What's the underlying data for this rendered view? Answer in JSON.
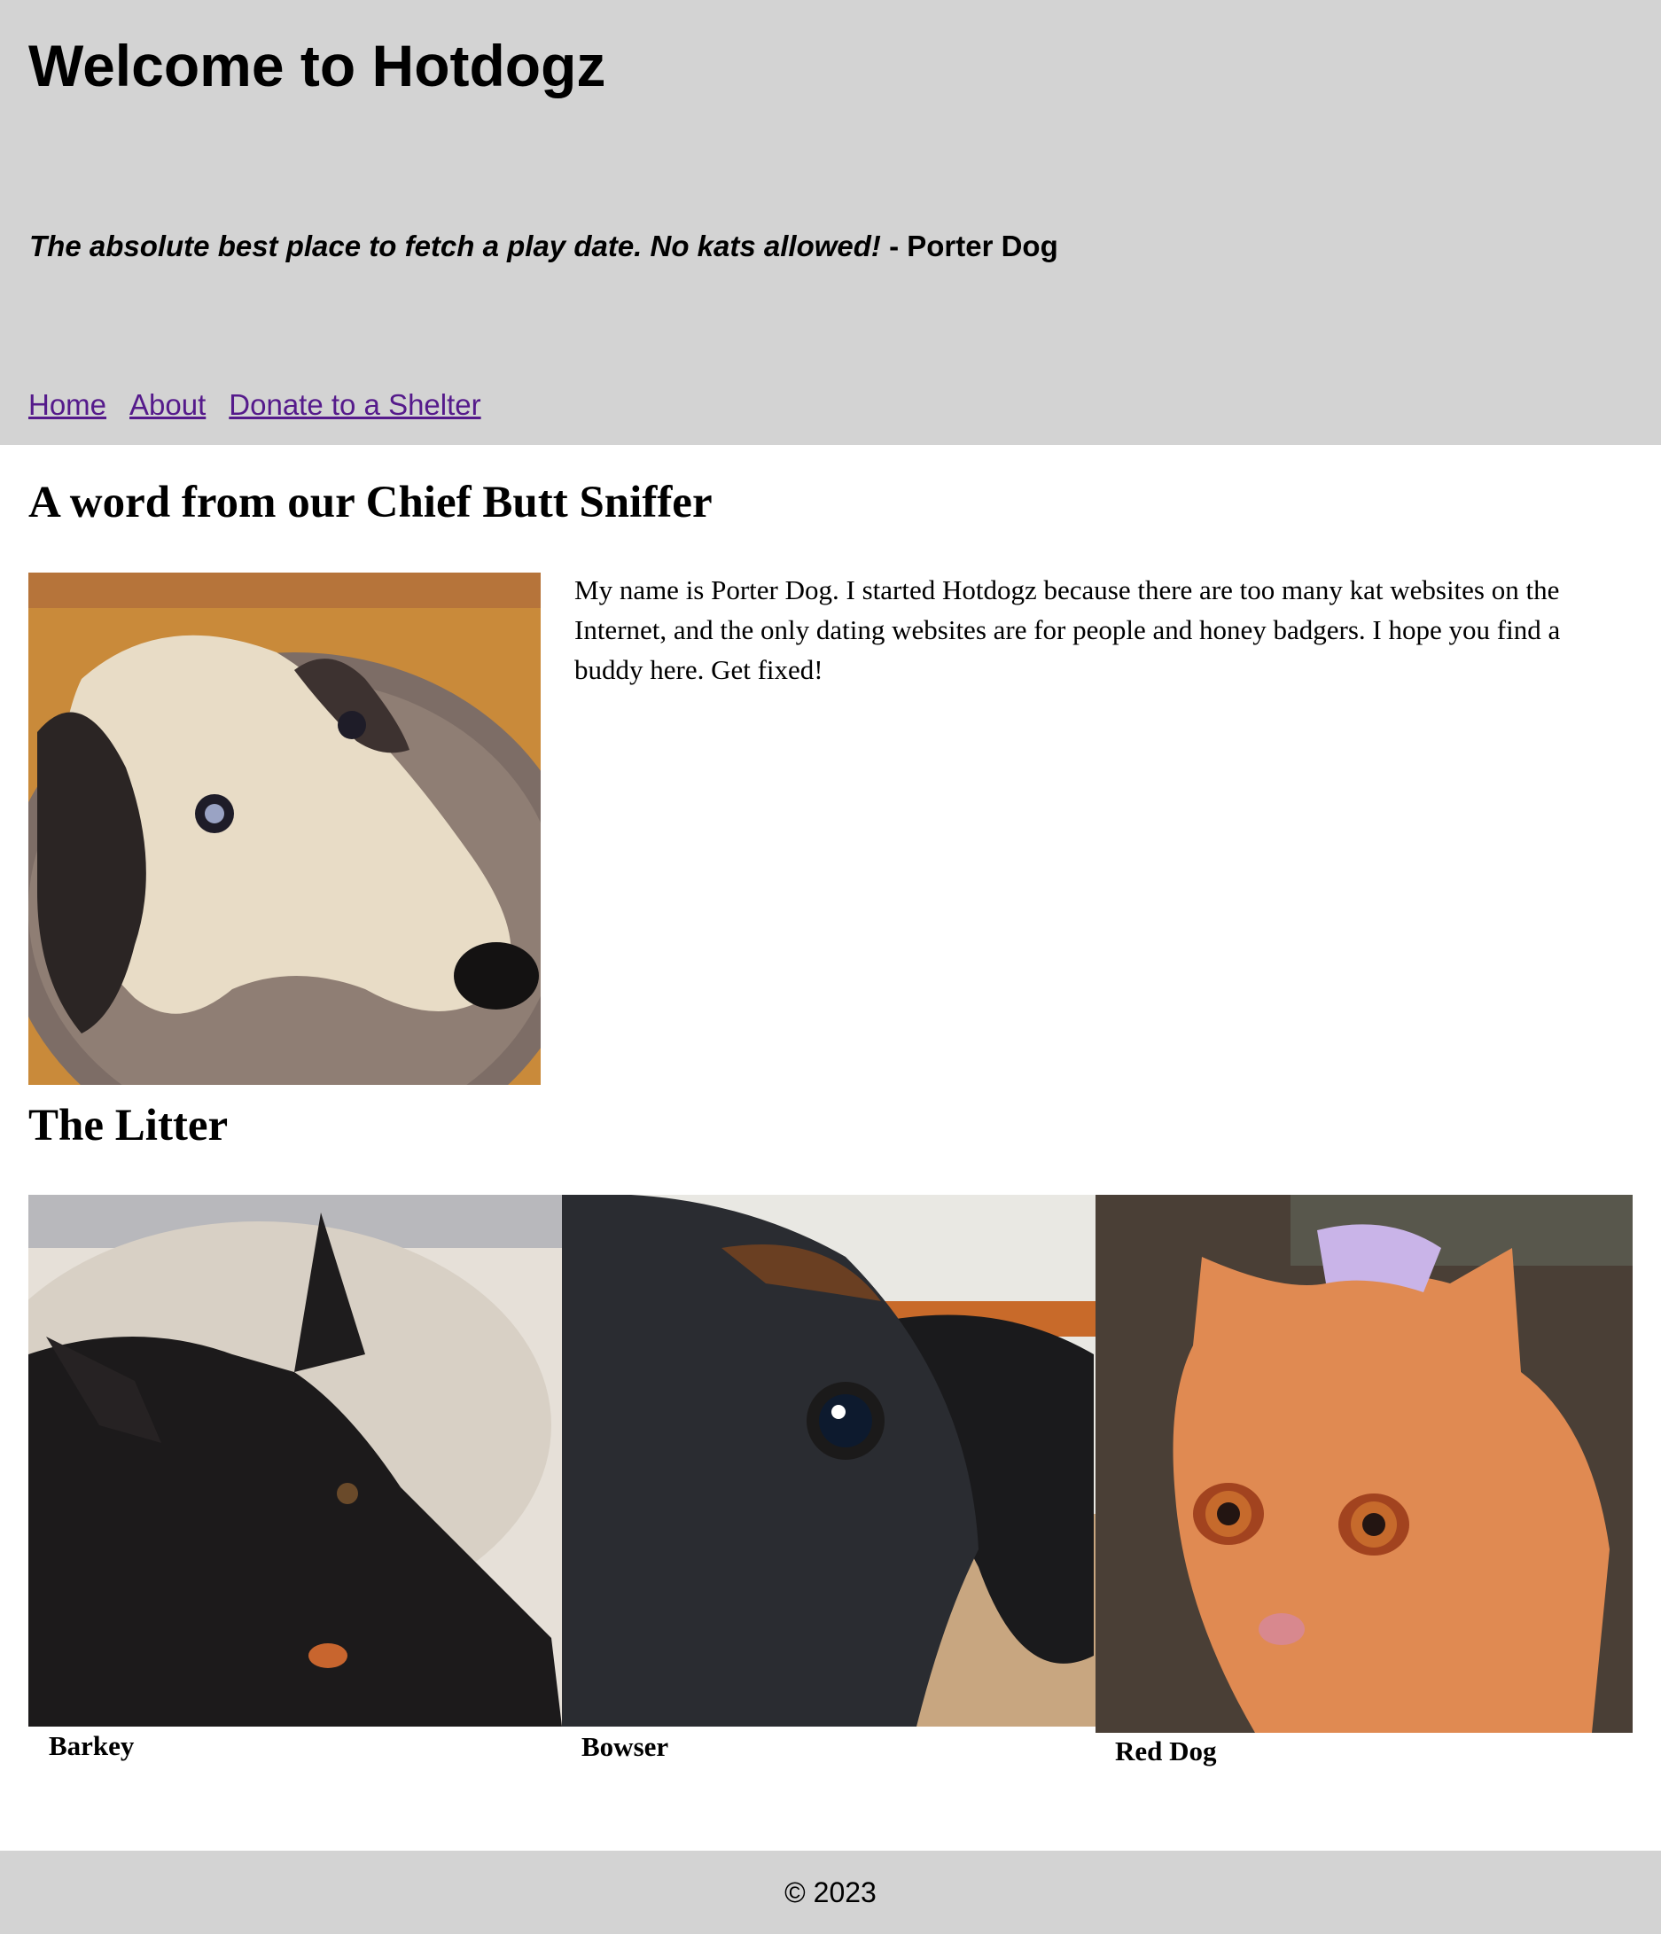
{
  "header": {
    "title": "Welcome to Hotdogz",
    "tagline_quote": "The absolute best place to fetch a play date. No kats allowed!",
    "tagline_author": " - Porter Dog",
    "nav": {
      "home": "Home",
      "about": "About",
      "donate": "Donate to a Shelter"
    }
  },
  "intro": {
    "heading": "A word from our Chief Butt Sniffer",
    "text": "My name is Porter Dog. I started Hotdogz because there are too many kat websites on the Internet, and the only dating websites are for people and honey badgers. I hope you find a buddy here. Get fixed!"
  },
  "litter": {
    "heading": "The Litter",
    "pets": [
      {
        "name": "Barkey"
      },
      {
        "name": "Bowser"
      },
      {
        "name": "Red Dog"
      }
    ]
  },
  "footer": {
    "text": "© 2023"
  },
  "colors": {
    "header_bg": "#d3d3d3",
    "footer_bg": "#d3d3d3",
    "link_visited": "#551a8b"
  }
}
